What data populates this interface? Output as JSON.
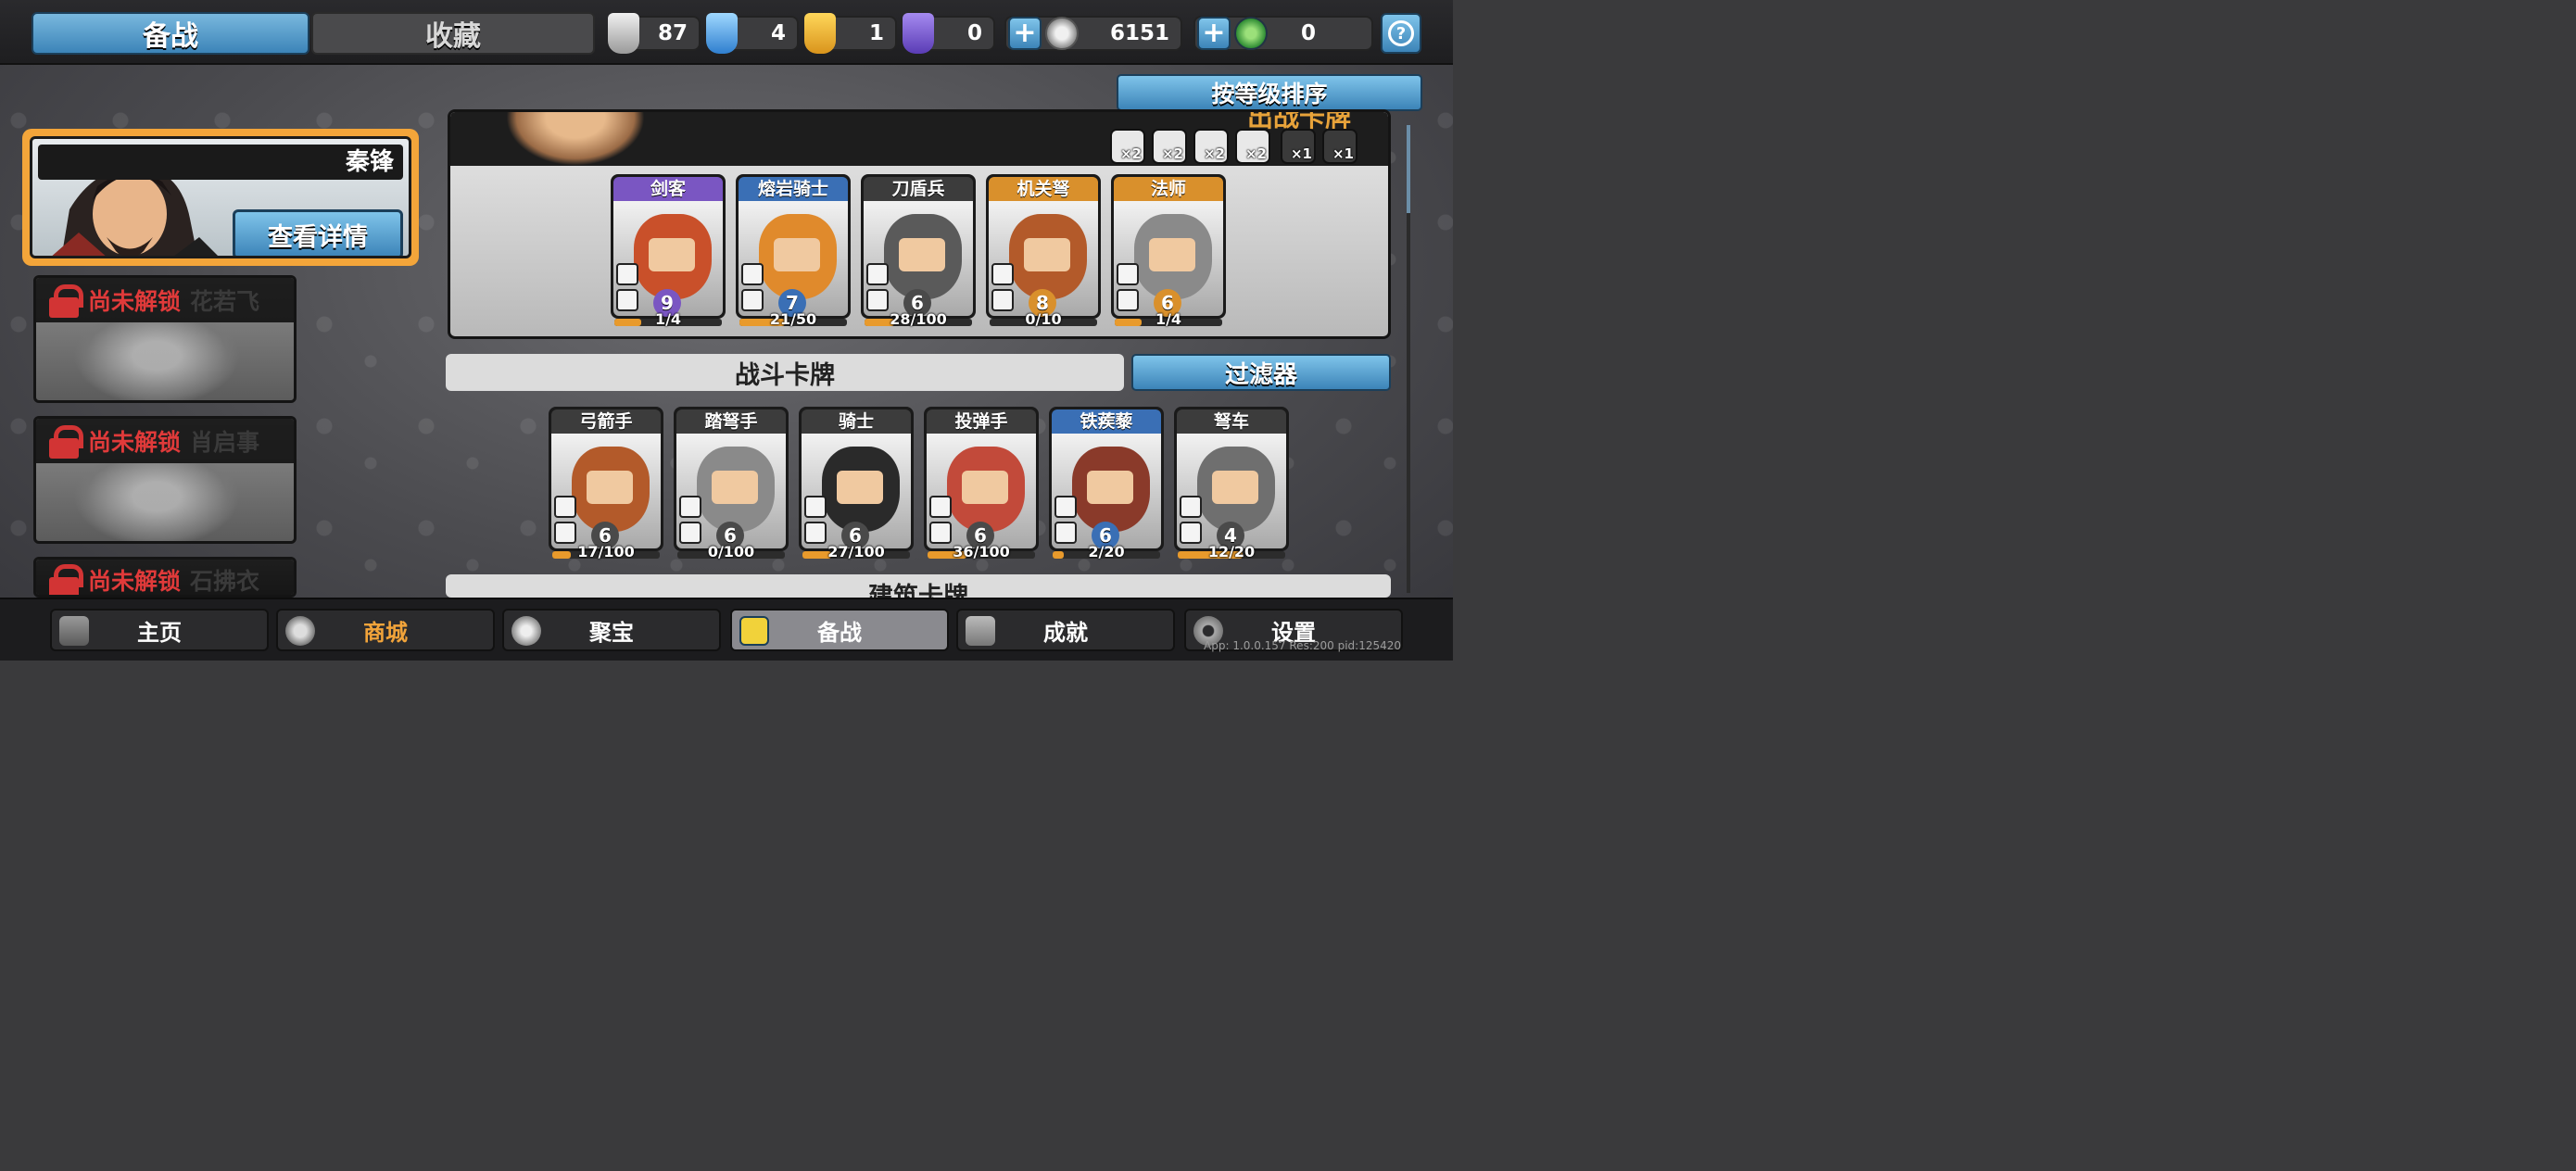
{
  "tabs": {
    "active": "备战",
    "inactive": "收藏"
  },
  "resources": [
    {
      "name": "silver-shield",
      "value": "87",
      "color": "#c8c8c8"
    },
    {
      "name": "blue-crystal",
      "value": "4",
      "color": "#4aa3e0"
    },
    {
      "name": "gold-shield",
      "value": "1",
      "color": "#e8b12b"
    },
    {
      "name": "purple-shield",
      "value": "0",
      "color": "#7a5bd0"
    },
    {
      "name": "silver-coin",
      "value": "6151",
      "color": "#d9d9d9"
    },
    {
      "name": "green-coin",
      "value": "0",
      "color": "#4db34a"
    }
  ],
  "sort_label": "按等级排序",
  "hero": {
    "name": "秦锋",
    "detail_label": "查看详情"
  },
  "locked_heroes": [
    {
      "status": "尚未解锁",
      "name": "花若飞"
    },
    {
      "status": "尚未解锁",
      "name": "肖启事"
    },
    {
      "status": "尚未解锁",
      "name": "石拂衣"
    }
  ],
  "deck": {
    "title": "出战卡牌",
    "modifiers": [
      "×2",
      "×2",
      "×2",
      "×2",
      "×1",
      "×1"
    ],
    "cards": [
      {
        "name": "剑客",
        "level": "9",
        "count": "1/4",
        "fill": 0.25,
        "header": "purple"
      },
      {
        "name": "熔岩骑士",
        "level": "7",
        "count": "21/50",
        "fill": 0.42,
        "header": "blue"
      },
      {
        "name": "刀盾兵",
        "level": "6",
        "count": "28/100",
        "fill": 0.28,
        "header": "grey"
      },
      {
        "name": "机关弩",
        "level": "8",
        "count": "0/10",
        "fill": 0.0,
        "header": "orange"
      },
      {
        "name": "法师",
        "level": "6",
        "count": "1/4",
        "fill": 0.25,
        "header": "orange"
      }
    ]
  },
  "battle_section": {
    "title": "战斗卡牌",
    "filter_label": "过滤器"
  },
  "battle_cards": [
    {
      "name": "弓箭手",
      "level": "6",
      "count": "17/100",
      "fill": 0.17,
      "header": "grey"
    },
    {
      "name": "踏弩手",
      "level": "6",
      "count": "0/100",
      "fill": 0.0,
      "header": "grey"
    },
    {
      "name": "骑士",
      "level": "6",
      "count": "27/100",
      "fill": 0.27,
      "header": "grey"
    },
    {
      "name": "投弹手",
      "level": "6",
      "count": "36/100",
      "fill": 0.36,
      "header": "grey"
    },
    {
      "name": "铁蒺藜",
      "level": "6",
      "count": "2/20",
      "fill": 0.1,
      "header": "blue"
    },
    {
      "name": "弩车",
      "level": "4",
      "count": "12/20",
      "fill": 0.6,
      "header": "grey"
    }
  ],
  "building_section": {
    "title": "建筑卡牌"
  },
  "nav": [
    {
      "label": "主页",
      "icon": "home-icon"
    },
    {
      "label": "商城",
      "icon": "shop-icon"
    },
    {
      "label": "聚宝",
      "icon": "treasure-icon"
    },
    {
      "label": "备战",
      "icon": "cards-icon"
    },
    {
      "label": "成就",
      "icon": "achievement-icon"
    },
    {
      "label": "设置",
      "icon": "gear-icon"
    }
  ],
  "app_info": "App: 1.0.0.157 Res:200 pid:125420"
}
